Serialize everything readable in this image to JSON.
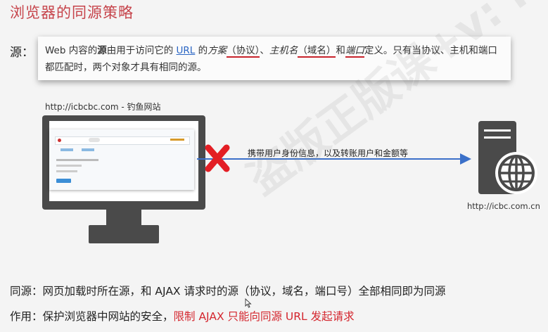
{
  "title": "浏览器的同源策略",
  "origin_label": "源：",
  "definition": {
    "p1": "Web 内容的",
    "bold": "源",
    "p2": "由用于访问它的 ",
    "link": "URL",
    "p3": " 的",
    "scheme": "方案",
    "scheme_note": "（协议）",
    "sep": "、",
    "host": "主机名",
    "host_note": "（域名）",
    "and": "和",
    "port": "端口",
    "p4": "定义。只有当协议、主机和端口都匹配时，两个对象才具有相同的源。"
  },
  "site_label": "http://icbcbc.com - 钓鱼网站",
  "server_label": "http://icbc.com.cn",
  "arrow_label": "携带用户身份信息，以及转账用户和金额等",
  "same_origin_line": "同源：网页加载时所在源，和 AJAX 请求时的源（协议，域名，端口号）全部相同即为同源",
  "purpose_prefix": "作用：保护浏览器中网站的安全，",
  "purpose_highlight": "限制 AJAX 只能向同源 URL 发起请求",
  "watermark": "盗版正版课+v: kunlung",
  "colors": {
    "title_red": "#c6434a",
    "highlight_red": "#d4262e",
    "link_blue": "#2b66c4",
    "arrow_blue": "#3b70c9",
    "cross_red": "#e31e24",
    "device_dark": "#4a4a4a"
  }
}
